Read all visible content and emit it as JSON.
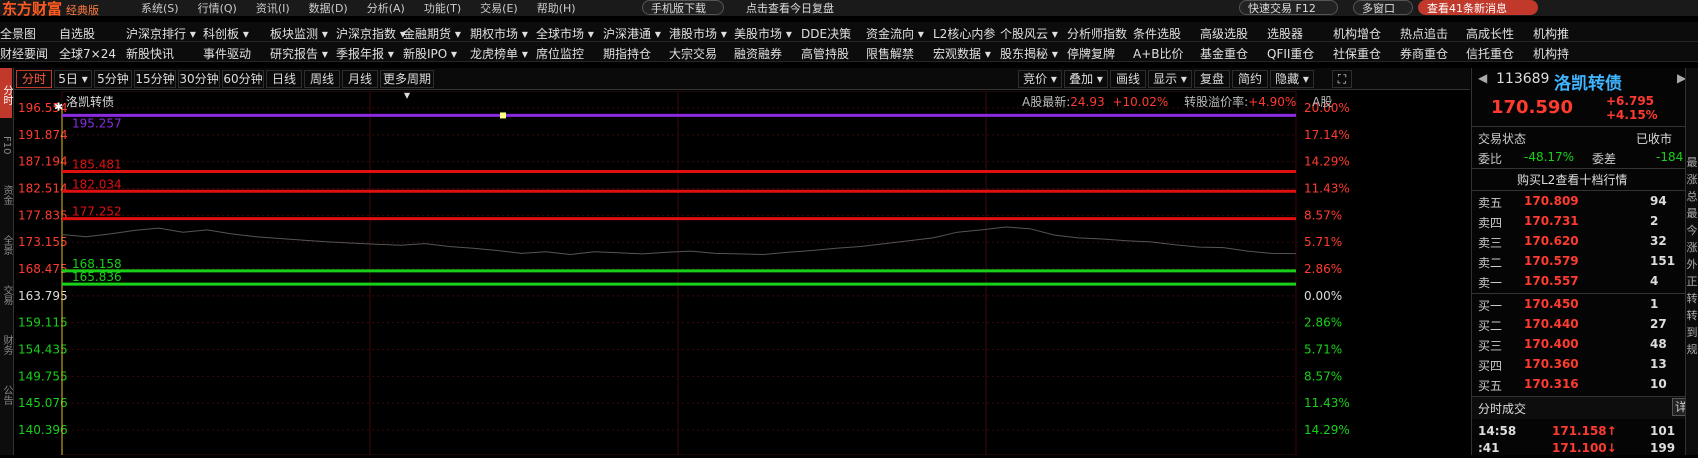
{
  "titlebar": {
    "logo": "东方财富",
    "edition": "经典版",
    "menu": [
      "系统(S)",
      "行情(Q)",
      "资讯(I)",
      "数据(D)",
      "分析(A)",
      "功能(T)",
      "交易(E)",
      "帮助(H)"
    ],
    "mobile_download": "手机版下载",
    "daily_review": "点击查看今日复盘",
    "quick_trade": "快速交易 F12",
    "multi_window": "多窗口",
    "news": "查看41条新消息"
  },
  "nav_row1": [
    "全景图",
    "自选股",
    "沪深京排行 ▾",
    "科创板 ▾",
    "板块监测 ▾",
    "沪深京指数 ▾",
    "金融期货 ▾",
    "期权市场 ▾",
    "全球市场 ▾",
    "沪深港通 ▾",
    "港股市场 ▾",
    "美股市场 ▾",
    "DDE决策",
    "资金流向 ▾",
    "L2核心内参",
    "个股风云 ▾",
    "分析师指数",
    "条件选股",
    "高级选股",
    "选股器",
    "机构增仓",
    "热点追击",
    "高成长性",
    "机构推"
  ],
  "nav_row2": [
    "财经要闻",
    "全球7×24",
    "新股快讯",
    "事件驱动",
    "研究报告 ▾",
    "季报年报 ▾",
    "新股IPO ▾",
    "龙虎榜单 ▾",
    "席位监控",
    "期指持仓",
    "大宗交易",
    "融资融券",
    "高管持股",
    "限售解禁",
    "宏观数据 ▾",
    "股东揭秘 ▾",
    "停牌复牌",
    "A+B比价",
    "基金重仓",
    "QFII重仓",
    "社保重仓",
    "券商重仓",
    "信托重仓",
    "机构持"
  ],
  "left_tabs": [
    "分时",
    "F10",
    "资金",
    "全景",
    "交易",
    "财务",
    "公告"
  ],
  "toolbar": {
    "periods": [
      "分时",
      "5日 ▾",
      "5分钟",
      "15分钟",
      "30分钟",
      "60分钟",
      "日线",
      "周线",
      "月线",
      "更多周期 ▾"
    ],
    "right": [
      "竞价 ▾",
      "叠加 ▾",
      "画线",
      "显示 ▾",
      "复盘",
      "简约",
      "隐藏 ▾"
    ],
    "expand_icon": "expand-icon"
  },
  "chart_info": {
    "stock_name": "洛凯转债",
    "a_share_latest_label": "A股最新:",
    "a_share_latest_value": "24.93",
    "a_share_pct": "+10.02%",
    "premium_label": "转股溢价率:",
    "premium_value": "+4.90%",
    "a_share_suffix": "A股"
  },
  "chart_data": {
    "type": "line",
    "title": "洛凯转债",
    "y_axis_ticks": [
      "196.554",
      "191.874",
      "187.194",
      "182.514",
      "177.835",
      "173.155",
      "168.475",
      "163.795",
      "159.115",
      "154.435",
      "149.755",
      "145.076",
      "140.396"
    ],
    "y_axis_right_ticks": [
      "20.00%",
      "17.14%",
      "14.29%",
      "11.43%",
      "8.57%",
      "5.71%",
      "2.86%",
      "0.00%",
      "2.86%",
      "5.71%",
      "8.57%",
      "11.43%",
      "14.29%"
    ],
    "ylim": [
      140.396,
      196.554
    ],
    "reference_lines": [
      {
        "value": 195.257,
        "label": "195.257",
        "color": "#8a2be2"
      },
      {
        "value": 185.481,
        "label": "185.481",
        "color": "#e01010"
      },
      {
        "value": 182.034,
        "label": "182.034",
        "color": "#e01010"
      },
      {
        "value": 177.252,
        "label": "177.252",
        "color": "#e01010"
      },
      {
        "value": 168.158,
        "label": "168.158",
        "color": "#18d018"
      },
      {
        "value": 165.836,
        "label": "165.836",
        "color": "#18d018"
      }
    ],
    "price_series": [
      174.5,
      174.1,
      174.6,
      175.2,
      175.6,
      174.9,
      175.3,
      174.6,
      174.1,
      173.8,
      173.5,
      173.2,
      173.0,
      172.8,
      172.6,
      172.9,
      172.4,
      172.1,
      171.7,
      171.2,
      171.5,
      171.0,
      171.5,
      171.3,
      171.1,
      171.4,
      171.6,
      171.2,
      171.1,
      171.0,
      171.4,
      171.7,
      172.1,
      172.4,
      172.9,
      173.4,
      173.9,
      174.9,
      175.3,
      175.8,
      175.5,
      174.4,
      173.9,
      173.7,
      173.4,
      173.2,
      172.7,
      172.3,
      172.2,
      171.6,
      171.2,
      171.158
    ],
    "colors": {
      "up": "#ff3b30",
      "down": "#18d018",
      "purple": "#8a2be2",
      "yellow_axis": "#e8c020"
    }
  },
  "quote": {
    "code": "113689",
    "name": "洛凯转债",
    "price": "170.590",
    "change": "+6.795",
    "change_pct": "+4.15%",
    "status_label": "交易状态",
    "status_value": "已收市",
    "wb_label": "委比",
    "wb_value": "-48.17%",
    "wc_label": "委差",
    "wc_value": "-184",
    "l2_link": "购买L2查看十档行情",
    "asks": [
      {
        "label": "卖五",
        "price": "170.809",
        "vol": "94"
      },
      {
        "label": "卖四",
        "price": "170.731",
        "vol": "2"
      },
      {
        "label": "卖三",
        "price": "170.620",
        "vol": "32"
      },
      {
        "label": "卖二",
        "price": "170.579",
        "vol": "151"
      },
      {
        "label": "卖一",
        "price": "170.557",
        "vol": "4"
      }
    ],
    "bids": [
      {
        "label": "买一",
        "price": "170.450",
        "vol": "1"
      },
      {
        "label": "买二",
        "price": "170.440",
        "vol": "27"
      },
      {
        "label": "买三",
        "price": "170.400",
        "vol": "48"
      },
      {
        "label": "买四",
        "price": "170.360",
        "vol": "13"
      },
      {
        "label": "买五",
        "price": "170.316",
        "vol": "10"
      }
    ],
    "ticks_title": "分时成交",
    "ticks_detail": "详",
    "ticks": [
      {
        "time": "14:58",
        "price": "171.158↑",
        "vol": "101"
      },
      {
        "time": ":41",
        "price": "171.100↓",
        "vol": "199"
      }
    ]
  },
  "edge_labels": [
    "最",
    "涨",
    "总",
    "最",
    "今",
    "涨",
    "外",
    "正",
    "转",
    "转",
    "到",
    "规"
  ]
}
